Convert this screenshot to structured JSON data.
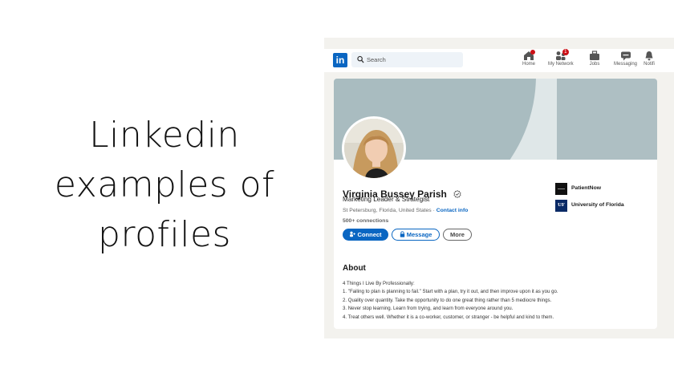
{
  "heading": {
    "lines": [
      "Linkedin",
      "examples of",
      "profiles"
    ]
  },
  "nav": {
    "logo": "in",
    "search_placeholder": "Search",
    "items": [
      {
        "label": "Home",
        "icon": "home-icon",
        "badge": ""
      },
      {
        "label": "My Network",
        "icon": "network-icon",
        "badge": "1"
      },
      {
        "label": "Jobs",
        "icon": "briefcase-icon",
        "badge": ""
      },
      {
        "label": "Messaging",
        "icon": "messaging-icon",
        "badge": ""
      },
      {
        "label": "Notifi",
        "icon": "bell-icon",
        "badge": ""
      }
    ]
  },
  "profile": {
    "name": "Virginia Bussey Parish",
    "headline": "Marketing Leader & Strategist",
    "location": "St Petersburg, Florida, United States · ",
    "contact_info": "Contact info",
    "connections": "500+ connections",
    "buttons": {
      "connect": "Connect",
      "message": "Message",
      "more": "More"
    },
    "orgs": [
      {
        "name": "PatientNow",
        "logo_color": "#111111"
      },
      {
        "name": "University of Florida",
        "logo_text": "UF",
        "logo_color": "#0a2a66"
      }
    ]
  },
  "about": {
    "title": "About",
    "lines": [
      "4 Things I Live By Professionally:",
      "1. \"Failing to plan is planning to fail.\" Start with a plan, try it out, and then improve upon it as you go.",
      "2. Quality over quantity. Take the opportunity to do one great thing rather than 5 mediocre things.",
      "3. Never stop learning. Learn from trying, and learn from everyone around you.",
      "4. Treat others well. Whether it is a co-worker, customer, or stranger - be helpful and kind to them."
    ]
  },
  "colors": {
    "brand": "#0a66c2",
    "cover_dark": "#a9bcc0",
    "cover_light": "#dfe7e8",
    "badge": "#cc1016",
    "panel_bg": "#f3f2ee"
  }
}
